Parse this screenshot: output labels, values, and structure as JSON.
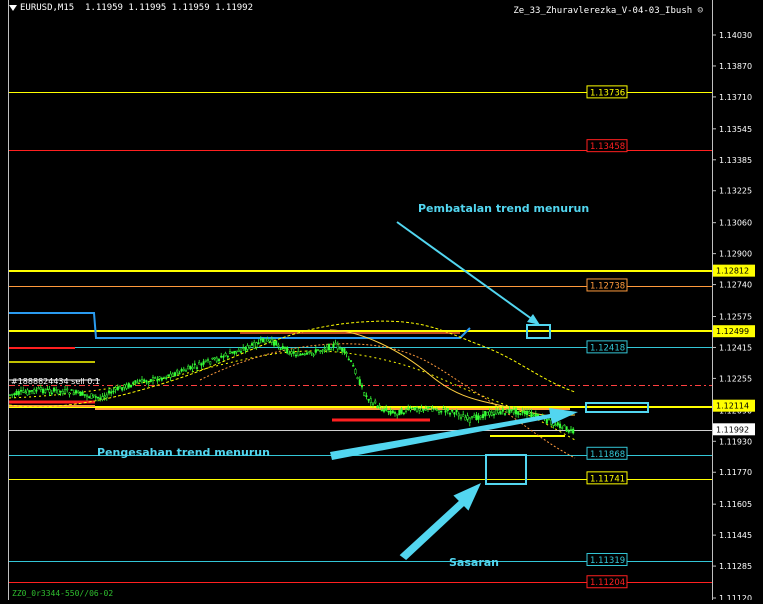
{
  "window": {
    "symbol_title": "EURUSD,M15  1.11959 1.11995 1.11959 1.11992",
    "indicator_name": "Ze_33_Zhuravlerezka_V-04-03_Ibush",
    "footer_label": "ZZ0_0r3344-550//06-02",
    "order_label": "#1888824434 sell 0.1"
  },
  "colors": {
    "background": "#000000",
    "axis": "#c0c0c0",
    "arrow": "#52d6f0",
    "yellow": "#ffff00",
    "red": "#ff2020",
    "orange": "#ff9a3c",
    "blue": "#2a9bf0",
    "teal": "#33c6d6",
    "candle": "#36ff36"
  },
  "price_axis": {
    "ticks": [
      "1.14030",
      "1.13870",
      "1.13710",
      "1.13545",
      "1.13385",
      "1.13225",
      "1.13060",
      "1.12900",
      "1.12740",
      "1.12575",
      "1.12415",
      "1.12255",
      "1.12090",
      "1.11930",
      "1.11770",
      "1.11605",
      "1.11445",
      "1.11285",
      "1.11120"
    ],
    "markers": [
      {
        "value": "1.12812",
        "bg": "#ffff00",
        "fg": "#000"
      },
      {
        "value": "1.12499",
        "bg": "#ffff00",
        "fg": "#000"
      },
      {
        "value": "1.12114",
        "bg": "#ffff00",
        "fg": "#000"
      },
      {
        "value": "1.11992",
        "bg": "#ffffff",
        "fg": "#000"
      }
    ]
  },
  "level_labels": [
    {
      "value": "1.13736",
      "color": "#ffff00"
    },
    {
      "value": "1.13458",
      "color": "#ff2020"
    },
    {
      "value": "1.12738",
      "color": "#ff9a3c"
    },
    {
      "value": "1.12418",
      "color": "#33c6d6"
    },
    {
      "value": "1.11868",
      "color": "#33c6d6"
    },
    {
      "value": "1.11741",
      "color": "#ffff00"
    },
    {
      "value": "1.11319",
      "color": "#33c6d6"
    },
    {
      "value": "1.11204",
      "color": "#ff2020"
    }
  ],
  "annotations": {
    "cancel_text": "Pembatalan trend menurun",
    "confirm_text": "Pengesahan trend menurun",
    "target_text": "Sasaran"
  }
}
